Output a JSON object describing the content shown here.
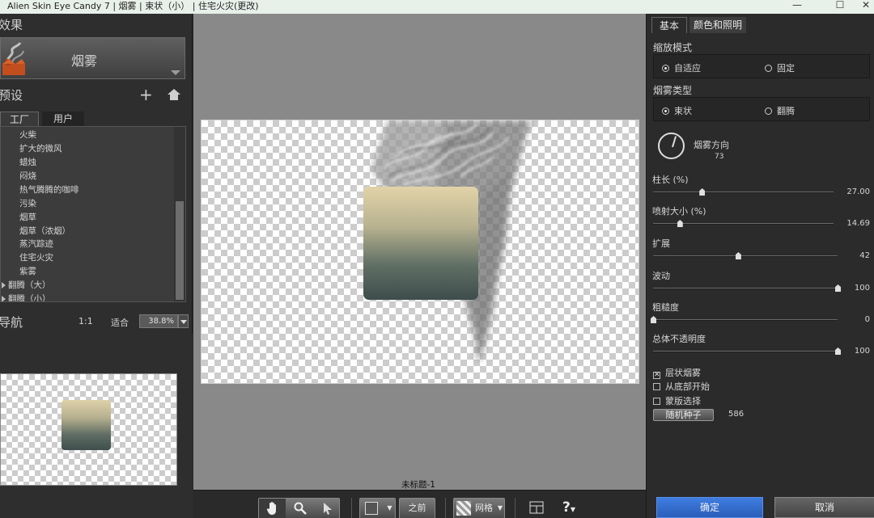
{
  "window": {
    "title": "Alien Skin Eye Candy 7 | 烟雾 | 束状（小） | 住宅火灾(更改)",
    "controls": [
      "minimize-icon",
      "maximize-icon",
      "close-icon"
    ]
  },
  "effects": {
    "section_title": "效果",
    "current_effect": "烟雾"
  },
  "presets": {
    "section_title": "预设",
    "add_icon": "plus-icon",
    "home_icon": "home-icon",
    "tabs": [
      {
        "label": "工厂",
        "active": true
      },
      {
        "label": "用户",
        "active": false
      }
    ],
    "items": [
      "火柴",
      "扩大的微风",
      "蜡烛",
      "闷烧",
      "热气腾腾的咖啡",
      "污染",
      "烟草",
      "烟草（浓烟）",
      "蒸汽踪迹",
      "住宅火灾",
      "紫雾"
    ],
    "groups": [
      "翻腾（大）",
      "翻腾（小）"
    ]
  },
  "navigator": {
    "section_title": "导航",
    "ratio_label": "1:1",
    "fit_label": "适合",
    "zoom_value": "38.8%"
  },
  "canvas": {
    "document_title": "未标题-1"
  },
  "toolbar": {
    "tools": [
      "hand-icon",
      "zoom-icon",
      "pointer-icon"
    ],
    "before_label": "之前",
    "grid_label": "网格",
    "help_icon": "question-icon"
  },
  "settings": {
    "tabs": [
      {
        "label": "基本",
        "active": true
      },
      {
        "label": "颜色和照明",
        "active": false
      }
    ],
    "zoom_mode": {
      "label": "缩放模式",
      "options": [
        {
          "label": "自适应",
          "selected": true
        },
        {
          "label": "固定",
          "selected": false
        }
      ]
    },
    "smoke_type": {
      "label": "烟雾类型",
      "options": [
        {
          "label": "束状",
          "selected": true
        },
        {
          "label": "翻腾",
          "selected": false
        }
      ]
    },
    "direction": {
      "label": "烟雾方向",
      "value": "73"
    },
    "sliders": [
      {
        "label": "柱长 (%)",
        "value": "27.00",
        "fraction": 0.27
      },
      {
        "label": "喷射大小 (%)",
        "value": "14.69",
        "fraction": 0.1469
      },
      {
        "label": "扩展",
        "value": "42",
        "fraction": 0.46
      },
      {
        "label": "波动",
        "value": "100",
        "fraction": 1.0
      },
      {
        "label": "粗糙度",
        "value": "0",
        "fraction": 0.0
      },
      {
        "label": "总体不透明度",
        "value": "100",
        "fraction": 1.0
      }
    ],
    "checkboxes": [
      {
        "label": "层状烟雾",
        "checked": true
      },
      {
        "label": "从底部开始",
        "checked": false
      },
      {
        "label": "蒙版选择",
        "checked": false
      }
    ],
    "random_seed_label": "随机种子",
    "random_seed_value": "586"
  },
  "actions": {
    "ok_label": "确定",
    "cancel_label": "取消",
    "ok_color": "#2f6ad0"
  }
}
